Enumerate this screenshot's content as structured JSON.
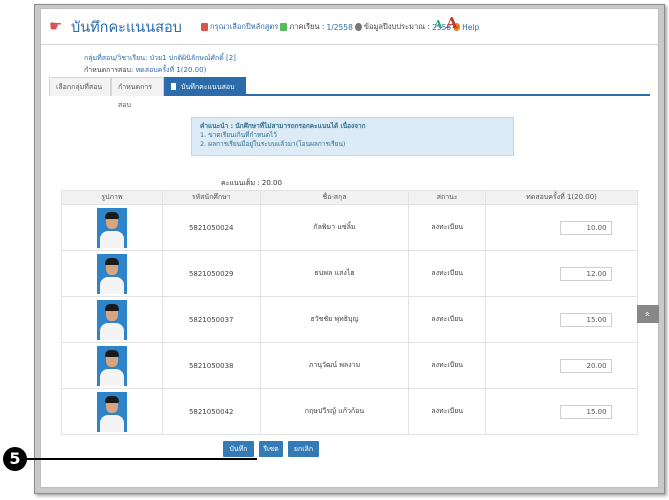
{
  "header": {
    "title": "บันทึกคะแนนสอบ",
    "course_link": "กรุณาเลือกปีหลักสูตร",
    "term_label": "ภาคเรียน :",
    "term_value": "1/2558",
    "budget_label": "ข้อมูลปีงบประมาณ :",
    "budget_value": "2558",
    "help_label": "Help",
    "font_small": "A",
    "font_large": "A"
  },
  "context": {
    "subject": "กลุ่มที่สอน/วิชาเรียน: ป่วย1 ปกติผินิลักษณ์ศักดิ์ [2]",
    "exam_label": "กำหนดการสอบ:",
    "exam_value": "ทดสอบครั้งที่ 1(20.00)"
  },
  "tabs": [
    {
      "label": "เลือกกลุ่มที่สอน",
      "active": false
    },
    {
      "label": "กำหนดการสอบ",
      "active": false
    },
    {
      "label": "บันทึกคะแนนสอบ",
      "active": true
    }
  ],
  "note": {
    "head": "คำแนะนำ : นักศึกษาที่ไม่สามารถกรอกคะแนนได้ เนื่องจาก",
    "line1": "1. ขาดเรียนเกินที่กำหนดไว้",
    "line2": "2. ผลการเรียนมีอยู่ในระบบแล้วมา(โอนผลการเรียน)"
  },
  "full_score": {
    "label": "คะแนนเต็ม :",
    "value": "20.00"
  },
  "table": {
    "headers": [
      "รูปภาพ",
      "รหัสนักศึกษา",
      "ชื่อ-สกุล",
      "สถานะ",
      "ทดสอบครั้งที่ 1(20.00)"
    ],
    "rows": [
      {
        "id": "5821050024",
        "name": "กัลพิมา แซ่ลิ้ม",
        "status": "ลงทะเบียน",
        "score": "10.00"
      },
      {
        "id": "5821050029",
        "name": "ธนพล แสงไฮ",
        "status": "ลงทะเบียน",
        "score": "12.00"
      },
      {
        "id": "5821050037",
        "name": "ธวัชชัย พุทธิบุญ",
        "status": "ลงทะเบียน",
        "score": "15.00"
      },
      {
        "id": "5821050038",
        "name": "ภานุวัฒน์ พลงาม",
        "status": "ลงทะเบียน",
        "score": "20.00"
      },
      {
        "id": "5821050042",
        "name": "กฤษปวีรญ์ แก้วก้อน",
        "status": "ลงทะเบียน",
        "score": "15.00"
      }
    ]
  },
  "actions": {
    "save": "บันทึก",
    "reset": "รีเซต",
    "cancel": "ยกเลิก"
  },
  "scroll_top": "»",
  "callout": {
    "number": "5"
  },
  "colors": {
    "accent": "#2c6cab",
    "button": "#337ab7",
    "note_bg": "#dcebf5"
  }
}
